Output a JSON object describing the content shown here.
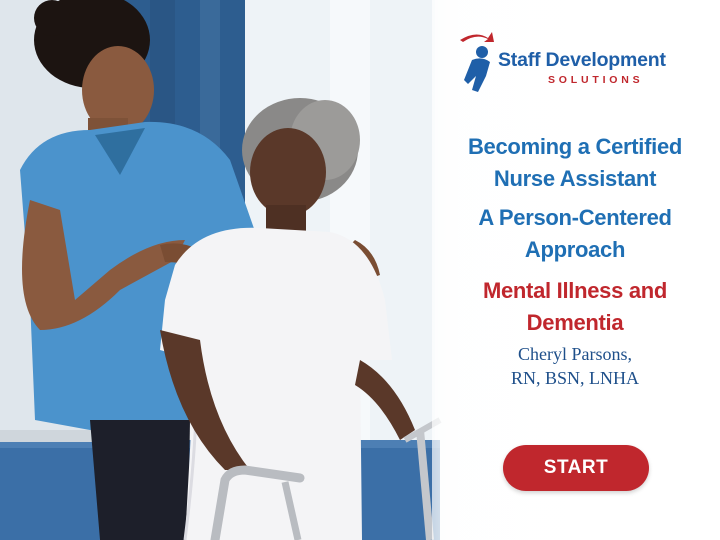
{
  "logo": {
    "name_line1": "Staff Development",
    "name_line2": "SOLUTIONS"
  },
  "titles": {
    "course": "Becoming a Certified Nurse Assistant",
    "approach": "A Person-Centered Approach",
    "module": "Mental Illness and Dementia"
  },
  "author": {
    "name": "Cheryl Parsons,",
    "credentials": "RN, BSN, LNHA"
  },
  "start_button": {
    "label": "START"
  },
  "colors": {
    "brand_blue": "#1f6fb4",
    "brand_red": "#c0272d"
  }
}
